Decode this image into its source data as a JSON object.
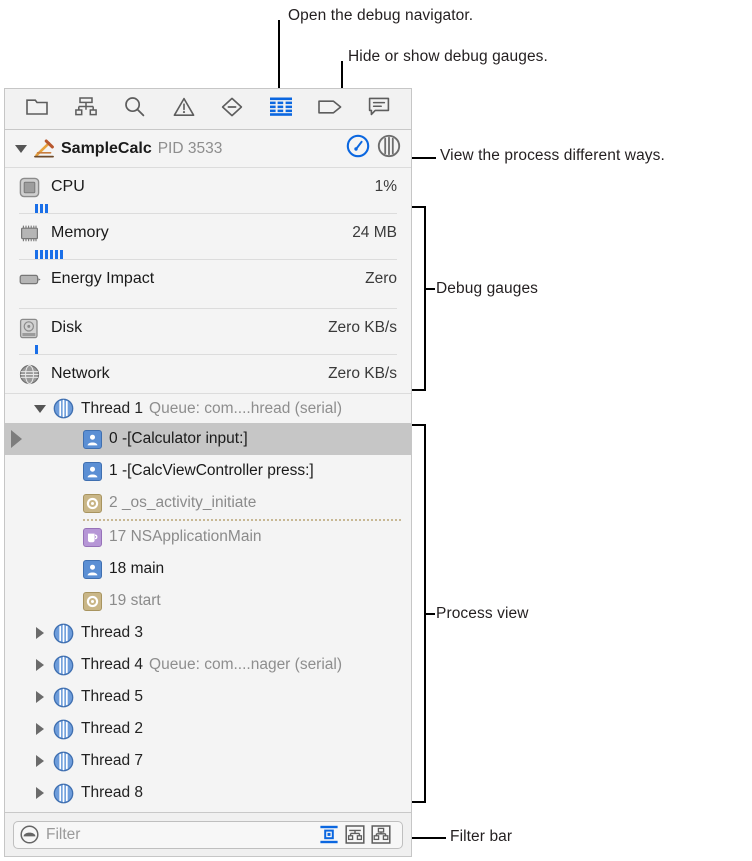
{
  "annotations": [
    {
      "id": "open-debug-navigator",
      "text": "Open the debug navigator."
    },
    {
      "id": "hide-show-debug-gauges",
      "text": "Hide or show debug gauges."
    },
    {
      "id": "view-process-different-ways",
      "text": "View the process different ways."
    },
    {
      "id": "debug-gauges",
      "text": "Debug gauges"
    },
    {
      "id": "process-view",
      "text": "Process view"
    },
    {
      "id": "filter-bar",
      "text": "Filter bar"
    }
  ],
  "toolbar": {
    "items": [
      {
        "icon": "folder-icon",
        "name": "project-navigator",
        "active": false
      },
      {
        "icon": "hierarchy-icon",
        "name": "source-control-navigator",
        "active": false
      },
      {
        "icon": "search-icon",
        "name": "find-navigator",
        "active": false
      },
      {
        "icon": "warning-triangle-icon",
        "name": "issue-navigator",
        "active": false
      },
      {
        "icon": "diamond-minus-icon",
        "name": "test-navigator",
        "active": false
      },
      {
        "icon": "debug-gauge-icon",
        "name": "debug-navigator",
        "active": true
      },
      {
        "icon": "tag-icon",
        "name": "breakpoint-navigator",
        "active": false
      },
      {
        "icon": "speech-bubble-icon",
        "name": "report-navigator",
        "active": false
      }
    ]
  },
  "process": {
    "app_icon": "xcode-hammer-icon",
    "name": "SampleCalc",
    "pid": "PID 3533",
    "expanded": true,
    "view_modes": [
      {
        "name": "gauges-view-toggle",
        "icon": "gauge-circle-icon",
        "active": true
      },
      {
        "name": "threads-view-toggle",
        "icon": "threads-circle-icon",
        "active": false
      }
    ]
  },
  "gauges": [
    {
      "name": "cpu",
      "icon": "cpu-chip-icon",
      "label": "CPU",
      "value": "1%",
      "spark": 3
    },
    {
      "name": "memory",
      "icon": "memory-chip-icon",
      "label": "Memory",
      "value": "24 MB",
      "spark": 6
    },
    {
      "name": "energy-impact",
      "icon": "battery-icon",
      "label": "Energy Impact",
      "value": "Zero",
      "spark": 0
    },
    {
      "name": "disk",
      "icon": "hard-disk-icon",
      "label": "Disk",
      "value": "Zero KB/s",
      "spark": 1
    },
    {
      "name": "network",
      "icon": "globe-icon",
      "label": "Network",
      "value": "Zero KB/s",
      "spark": 0
    }
  ],
  "threads": [
    {
      "name": "Thread 1",
      "queue": "Queue: com....hread (serial)",
      "expanded": true,
      "frames": [
        {
          "index": "0",
          "label": "-[Calculator input:]",
          "kind": "user",
          "selected": true,
          "current": true,
          "dim": false,
          "divider_after": false
        },
        {
          "index": "1",
          "label": "-[CalcViewController press:]",
          "kind": "user",
          "selected": false,
          "current": false,
          "dim": false,
          "divider_after": false
        },
        {
          "index": "2",
          "label": "_os_activity_initiate",
          "kind": "system",
          "selected": false,
          "current": false,
          "dim": true,
          "divider_after": true
        },
        {
          "index": "17",
          "label": "NSApplicationMain",
          "kind": "framework",
          "selected": false,
          "current": false,
          "dim": true,
          "divider_after": false
        },
        {
          "index": "18",
          "label": "main",
          "kind": "user",
          "selected": false,
          "current": false,
          "dim": false,
          "divider_after": false
        },
        {
          "index": "19",
          "label": "start",
          "kind": "system",
          "selected": false,
          "current": false,
          "dim": true,
          "divider_after": false
        }
      ]
    },
    {
      "name": "Thread 3",
      "queue": "",
      "expanded": false,
      "frames": []
    },
    {
      "name": "Thread 4",
      "queue": "Queue: com....nager (serial)",
      "expanded": false,
      "frames": []
    },
    {
      "name": "Thread 5",
      "queue": "",
      "expanded": false,
      "frames": []
    },
    {
      "name": "Thread 2",
      "queue": "",
      "expanded": false,
      "frames": []
    },
    {
      "name": "Thread 7",
      "queue": "",
      "expanded": false,
      "frames": []
    },
    {
      "name": "Thread 8",
      "queue": "",
      "expanded": false,
      "frames": []
    }
  ],
  "filter": {
    "icon": "filter-lens-icon",
    "value": "",
    "placeholder": "Filter",
    "toggles": [
      {
        "name": "show-only-crashed-threads-toggle",
        "icon": "filter-frames-icon",
        "active": true
      },
      {
        "name": "show-only-relevant-frames-toggle",
        "icon": "filter-stack-icon",
        "active": false
      },
      {
        "name": "show-all-frames-toggle",
        "icon": "filter-blocks-icon",
        "active": false
      }
    ]
  },
  "colors": {
    "accent": "#1a6fe8",
    "panel_bg": "#f4f4f4",
    "selection": "#c6c6c6",
    "dim_text": "#8e8e8e"
  }
}
